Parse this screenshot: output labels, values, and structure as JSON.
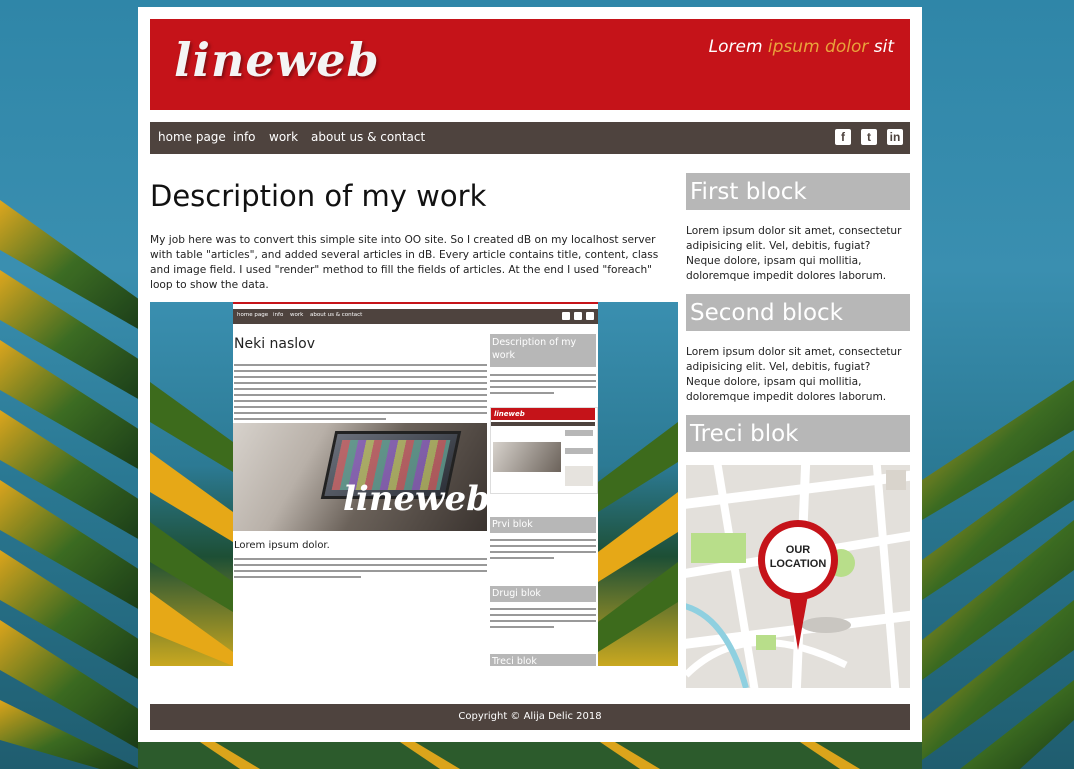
{
  "header": {
    "logo": "lineweb",
    "tagline_part1": "Lorem ",
    "tagline_highlight": "ipsum dolor",
    "tagline_part2": " sit"
  },
  "nav": {
    "items": [
      "home page",
      "info",
      "work",
      "about us & contact"
    ],
    "social_icons": [
      "facebook-icon",
      "twitter-icon",
      "linkedin-icon"
    ]
  },
  "main": {
    "title": "Description of my work",
    "text": "My job here was to convert this simple site into OO site. So I created dB on my localhost server with table \"articles\", and added several articles in dB. Every article contains title, content, class and image field. I used \"render\" method to fill the fields of articles. At the end I used \"foreach\" loop to show the data."
  },
  "screenshot": {
    "nav_items": [
      "home page",
      "info",
      "work",
      "about us & contact"
    ],
    "title": "Neki naslov",
    "photo_logo": "lineweb",
    "subtitle": "Lorem ipsum dolor.",
    "side_blocks": [
      "Description of my work",
      "Prvi blok",
      "Drugi blok",
      "Treci blok"
    ],
    "side_text": "My job here was to convert this simple site into OO site.So I created objects for articles on main and sidebar part of the site. Objects are saved on podaci.php file.",
    "mini_logo": "lineweb"
  },
  "sidebar": {
    "blocks": [
      {
        "title": "First block",
        "text": "Lorem ipsum dolor sit amet, consectetur adipisicing elit. Vel, debitis, fugiat? Neque dolore, ipsam qui mollitia, doloremque impedit dolores laborum."
      },
      {
        "title": "Second block",
        "text": "Lorem ipsum dolor sit amet, consectetur adipisicing elit. Vel, debitis, fugiat? Neque dolore, ipsam qui mollitia, doloremque impedit dolores laborum."
      },
      {
        "title": "Treci blok",
        "text": ""
      }
    ],
    "map_label_line1": "OUR",
    "map_label_line2": "LOCATION"
  },
  "footer": {
    "text": "Copyright © Alija Delic 2018"
  },
  "colors": {
    "header_red": "#c51319",
    "nav_brown": "#4e433e",
    "block_gray": "#b7b7b7",
    "tagline_accent": "#e9a33b"
  }
}
